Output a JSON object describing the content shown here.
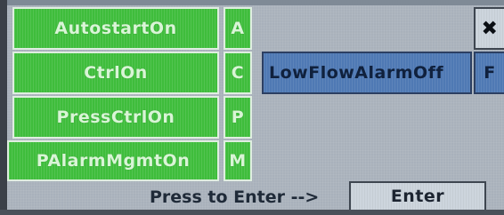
{
  "panel": {
    "left_buttons": [
      {
        "label": "AutostartOn",
        "key": "A"
      },
      {
        "label": "CtrlOn",
        "key": "C"
      },
      {
        "label": "PressCtrlOn",
        "key": "P"
      },
      {
        "label": "PAlarmMgmtOn",
        "key": "M"
      }
    ],
    "alarm_button": {
      "label": "LowFlowAlarmOff",
      "key": "F"
    },
    "close_icon": "close-icon",
    "prompt_text": "Press to Enter -->",
    "enter_button": "Enter"
  },
  "colors": {
    "green_button": "#3fbd3c",
    "blue_button": "#4f79b4",
    "panel_background": "#a9b1bb"
  }
}
